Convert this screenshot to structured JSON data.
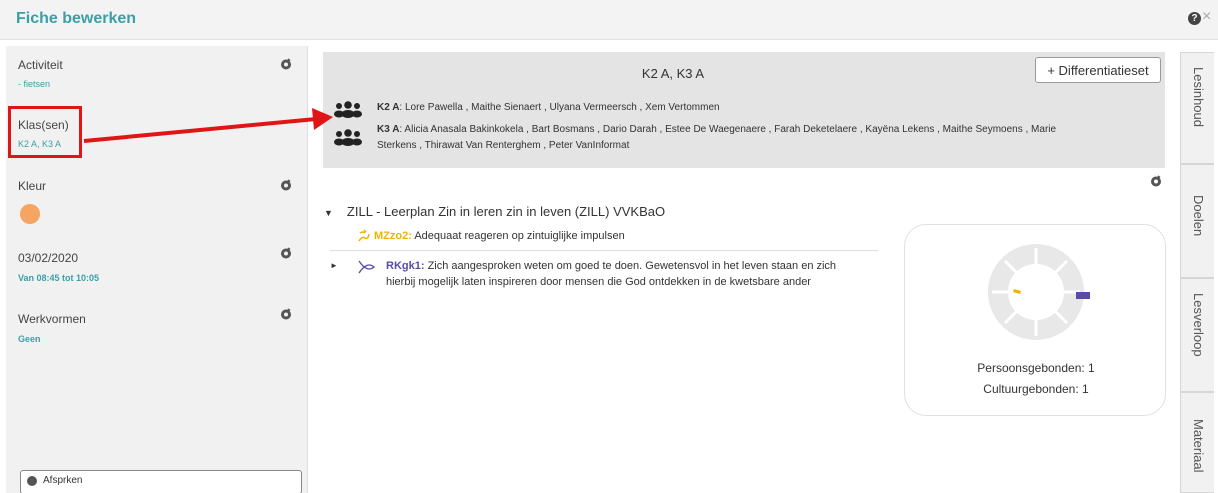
{
  "header": {
    "title": "Fiche bewerken",
    "help_icon": "?",
    "close_icon": "×"
  },
  "sidebar": {
    "activiteit": {
      "label": "Activiteit",
      "value": "- fietsen"
    },
    "klassen": {
      "label": "Klas(sen)",
      "value": "K2 A, K3 A"
    },
    "kleur": {
      "label": "Kleur",
      "color": "#f5a462"
    },
    "datum": {
      "label": "03/02/2020",
      "value": "Van 08:45 tot 10:05"
    },
    "werkvormen": {
      "label": "Werkvormen",
      "value": "Geen"
    },
    "bottom_button": "Afsprken"
  },
  "classes": {
    "title": "K2 A, K3 A",
    "diff_button": "+ Differentiatieset",
    "rows": [
      {
        "name": "K2 A",
        "students": ": Lore Pawella , Maithe Sienaert , Ulyana Vermeersch , Xem Vertommen"
      },
      {
        "name": "K3 A",
        "students": ": Alicia Anasala Bakinkokela , Bart Bosmans , Dario Darah , Estee De Waegenaere , Farah Deketelaere , Kayëna Lekens , Maithe Seymoens , Marie",
        "students_line2": "Sterkens , Thirawat Van Renterghem , Peter VanInformat"
      }
    ]
  },
  "tabs": [
    "Lesinhoud",
    "Doelen",
    "Lesverloop",
    "Materiaal"
  ],
  "goals": {
    "caret": "▼",
    "title": "ZILL - Leerplan Zin in leren zin in leven (ZILL) VVKBaO",
    "items": [
      {
        "code": "MZzo2:",
        "text": " Adequaat reageren op zintuiglijke impulsen"
      },
      {
        "caret": "►",
        "code": "RKgk1:",
        "text": " Zich aangesproken weten om goed te doen. Gewetensvol in het leven staan en zich",
        "text_line2": "hierbij mogelijk laten inspireren door mensen die God ontdekken in de kwetsbare ander"
      }
    ]
  },
  "stats": {
    "lines": [
      "Persoonsgebonden: 1",
      "Cultuurgebonden: 1"
    ],
    "ring_colors": {
      "base": "#e8e8e8",
      "accent1": "#f0b400",
      "accent2": "#5b4aa8"
    }
  },
  "colors": {
    "accent": "#3aa0a6",
    "highlight": "#e01515"
  }
}
